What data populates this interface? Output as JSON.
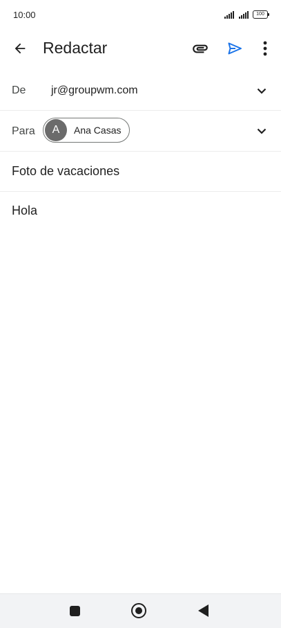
{
  "status_bar": {
    "time": "10:00",
    "battery": "100"
  },
  "app_bar": {
    "title": "Redactar",
    "icons": [
      "back-arrow-icon",
      "attachment-icon",
      "send-icon",
      "more-vert-icon"
    ],
    "send_color": "#1a73e8"
  },
  "compose": {
    "from_label": "De",
    "from_value": "jr@groupwm.com",
    "to_label": "Para",
    "recipient": {
      "initial": "A",
      "name": "Ana Casas"
    },
    "subject": "Foto de vacaciones",
    "body": "Hola"
  },
  "nav_bar": {
    "icons": [
      "recents-square-icon",
      "home-circle-icon",
      "back-triangle-icon"
    ]
  }
}
